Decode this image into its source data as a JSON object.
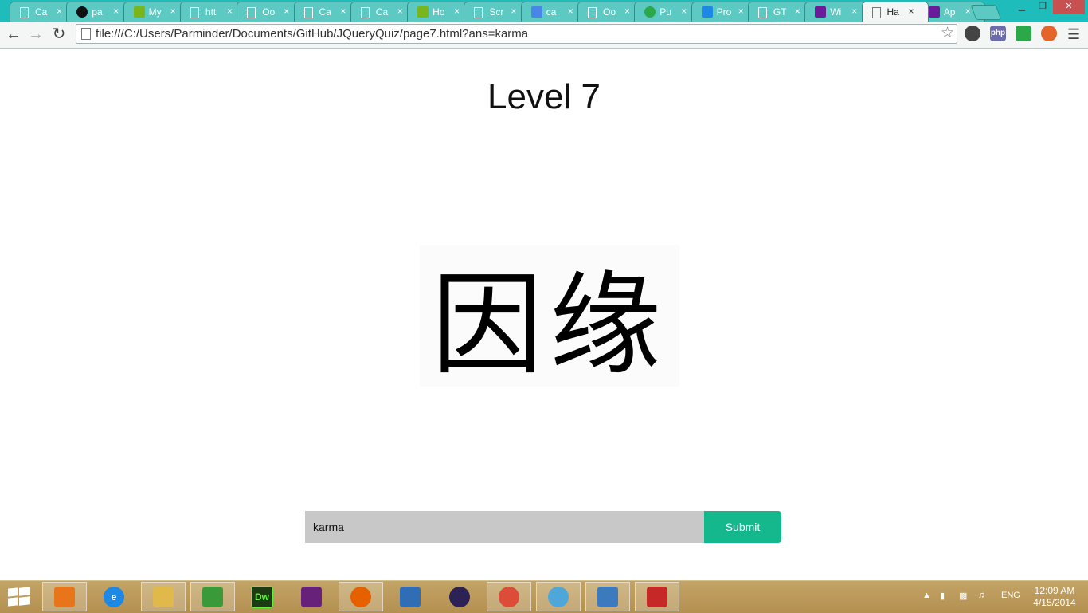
{
  "browser": {
    "tabs": [
      {
        "label": "Ca",
        "icon": "page-icon"
      },
      {
        "label": "pa",
        "icon": "github-icon"
      },
      {
        "label": "My",
        "icon": "puzzle-icon"
      },
      {
        "label": "htt",
        "icon": "page-icon"
      },
      {
        "label": "Oo",
        "icon": "page-icon"
      },
      {
        "label": "Ca",
        "icon": "page-icon"
      },
      {
        "label": "Ca",
        "icon": "page-icon"
      },
      {
        "label": "Ho",
        "icon": "puzzle-icon"
      },
      {
        "label": "Scr",
        "icon": "page-icon"
      },
      {
        "label": "ca",
        "icon": "google-icon"
      },
      {
        "label": "Oo",
        "icon": "page-icon"
      },
      {
        "label": "Pu",
        "icon": "pushbullet-icon"
      },
      {
        "label": "Pro",
        "icon": "dropbox-icon"
      },
      {
        "label": "GT",
        "icon": "page-icon"
      },
      {
        "label": "Wi",
        "icon": "windows-icon"
      },
      {
        "label": "Ha",
        "icon": "page-icon",
        "active": true
      },
      {
        "label": "Ap",
        "icon": "windows-icon"
      }
    ],
    "close_glyph": "×",
    "window_controls": {
      "minimize": "▁",
      "maximize": "❐",
      "close": "✕"
    },
    "address": "file:///C:/Users/Parminder/Documents/GitHub/JQueryQuiz/page7.html?ans=karma",
    "extensions": [
      "php"
    ]
  },
  "page": {
    "title": "Level 7",
    "glyph_text": "因缘",
    "answer_value": "karma",
    "submit_label": "Submit"
  },
  "taskbar": {
    "apps": [
      {
        "name": "media-player",
        "label": ""
      },
      {
        "name": "internet-explorer",
        "label": "e"
      },
      {
        "name": "file-explorer",
        "label": ""
      },
      {
        "name": "task-manager",
        "label": ""
      },
      {
        "name": "dreamweaver",
        "label": "Dw"
      },
      {
        "name": "visual-studio",
        "label": ""
      },
      {
        "name": "firefox",
        "label": ""
      },
      {
        "name": "virtualbox",
        "label": ""
      },
      {
        "name": "eclipse",
        "label": ""
      },
      {
        "name": "chrome",
        "label": ""
      },
      {
        "name": "github",
        "label": ""
      },
      {
        "name": "photo-viewer",
        "label": ""
      },
      {
        "name": "snipping-tool",
        "label": ""
      }
    ],
    "language": "ENG",
    "time": "12:09 AM",
    "date": "4/15/2014"
  }
}
